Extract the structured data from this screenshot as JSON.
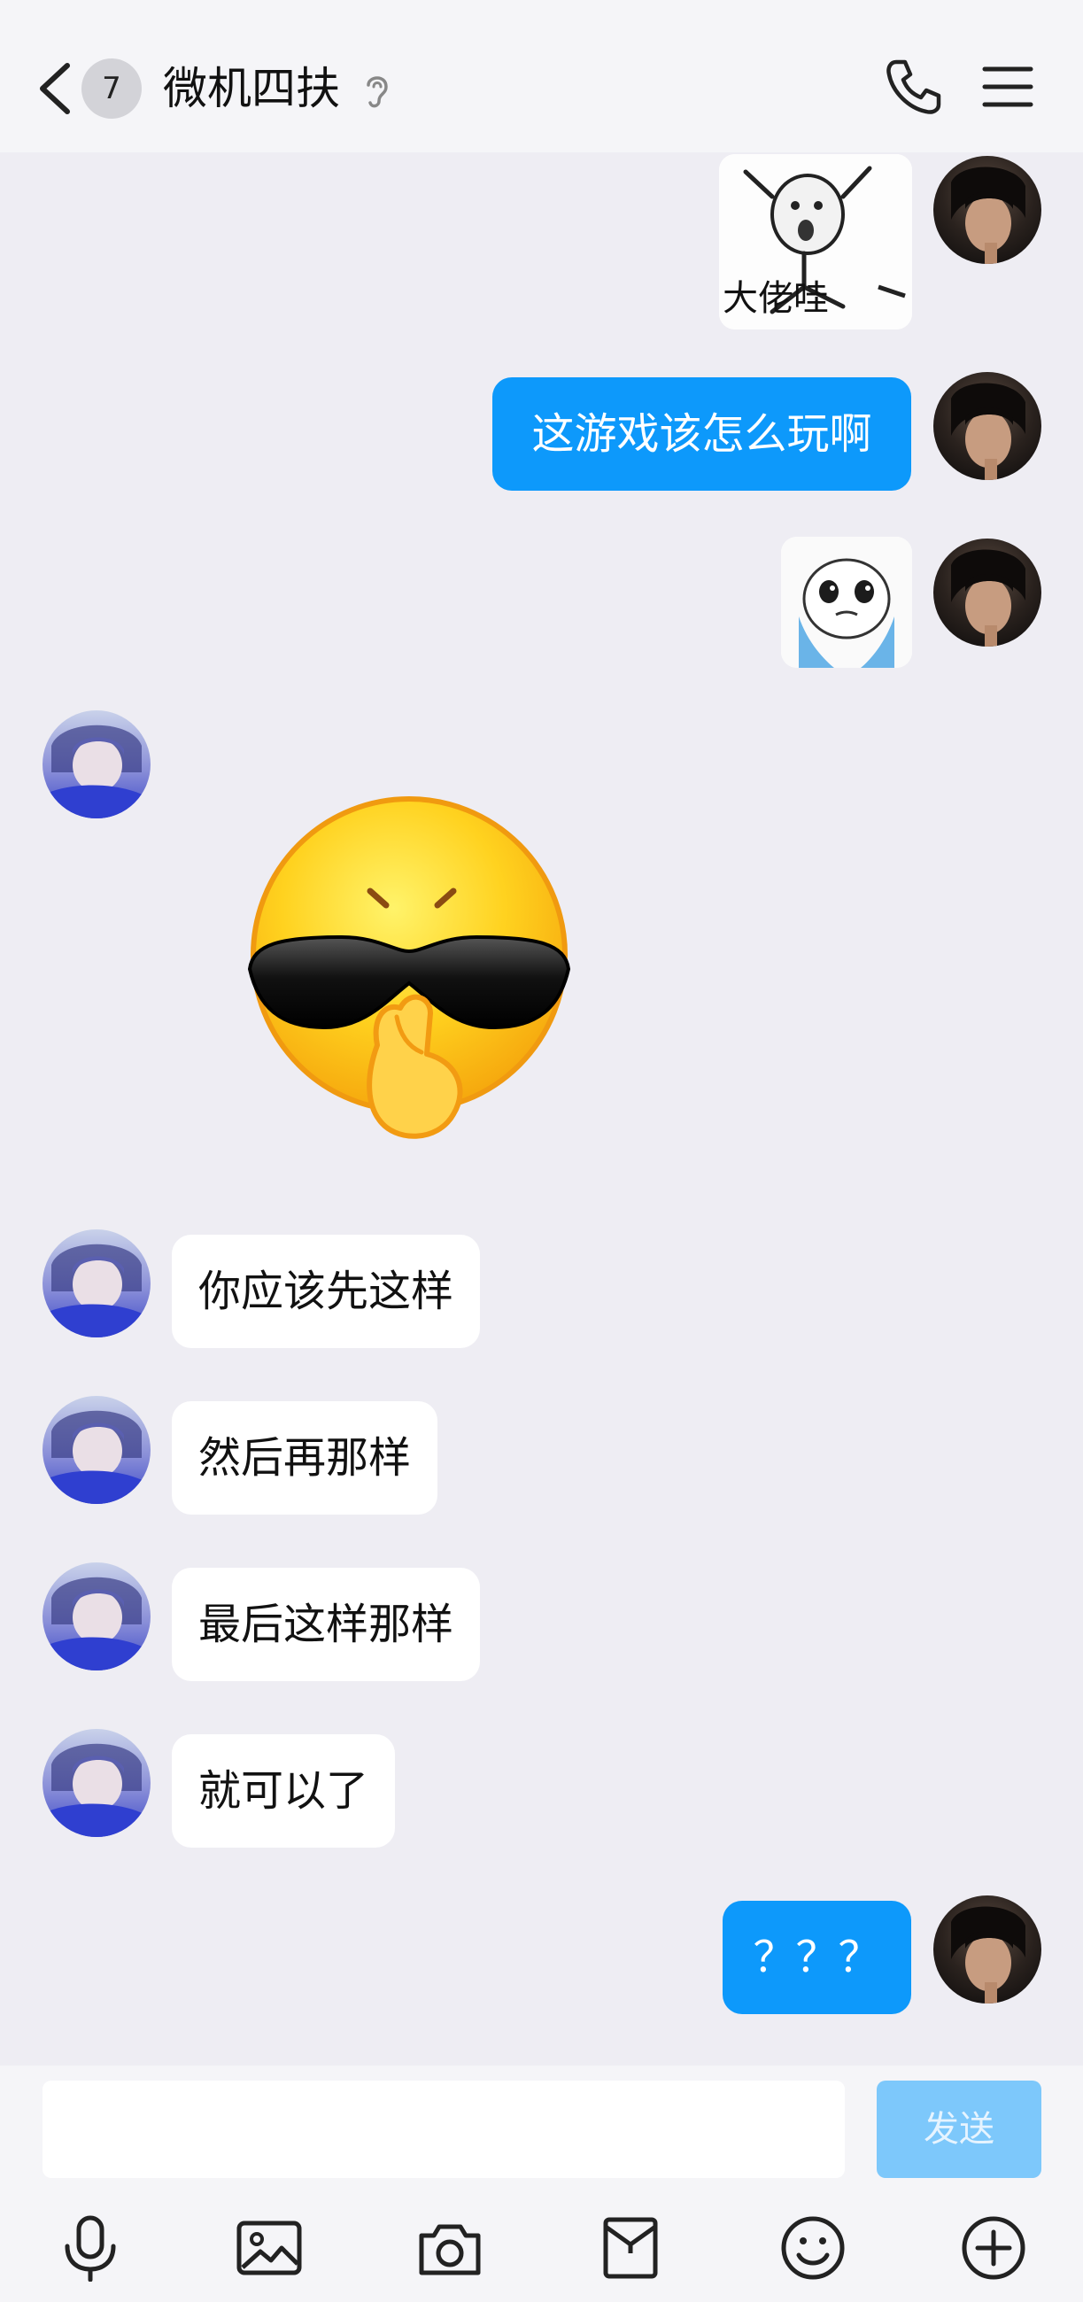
{
  "header": {
    "unread_count": "7",
    "title": "微机四扶",
    "icons": [
      "back-icon",
      "ear-icon",
      "phone-icon",
      "menu-icon"
    ]
  },
  "messages": [
    {
      "side": "right",
      "type": "sticker",
      "caption": "大佬哇"
    },
    {
      "side": "right",
      "type": "text",
      "text": "这游戏该怎么玩啊"
    },
    {
      "side": "right",
      "type": "sticker",
      "caption": ""
    },
    {
      "side": "left",
      "type": "emoji",
      "emoji": "sunglasses-shush-emoji"
    },
    {
      "side": "left",
      "type": "text",
      "text": "你应该先这样"
    },
    {
      "side": "left",
      "type": "text",
      "text": "然后再那样"
    },
    {
      "side": "left",
      "type": "text",
      "text": "最后这样那样"
    },
    {
      "side": "left",
      "type": "text",
      "text": "就可以了"
    },
    {
      "side": "right",
      "type": "text",
      "text": "？？？"
    }
  ],
  "input": {
    "value": "",
    "placeholder": "",
    "send_label": "发送"
  },
  "toolbar": [
    "microphone-icon",
    "image-icon",
    "camera-icon",
    "red-packet-icon",
    "emoji-icon",
    "plus-icon"
  ],
  "colors": {
    "outgoing_bubble": "#0d99fb",
    "incoming_bubble": "#ffffff",
    "background": "#eeedf3",
    "send_button_disabled": "#7dc8fb"
  }
}
